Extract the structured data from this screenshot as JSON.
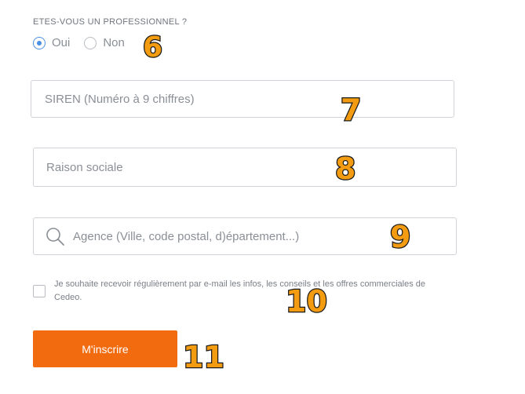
{
  "form": {
    "question": "ETES-VOUS UN PROFESSIONNEL ?",
    "radios": [
      {
        "label": "Oui",
        "checked": true
      },
      {
        "label": "Non",
        "checked": false
      }
    ],
    "siren_placeholder": "SIREN (Numéro à 9 chiffres)",
    "raison_placeholder": "Raison sociale",
    "agence_placeholder": "Agence (Ville, code postal, d)épartement...)",
    "consent_text": "Je souhaite recevoir régulièrement par e-mail les infos, les conseils et les offres commerciales de Cedeo.",
    "submit_label": "M'inscrire"
  },
  "annotations": {
    "n6": "6",
    "n7": "7",
    "n8": "8",
    "n9": "9",
    "n10": "10",
    "n11": "11"
  },
  "colors": {
    "accent": "#f26b0f",
    "radio_selected": "#4a90e2",
    "annotation_fill": "#f39c12"
  }
}
